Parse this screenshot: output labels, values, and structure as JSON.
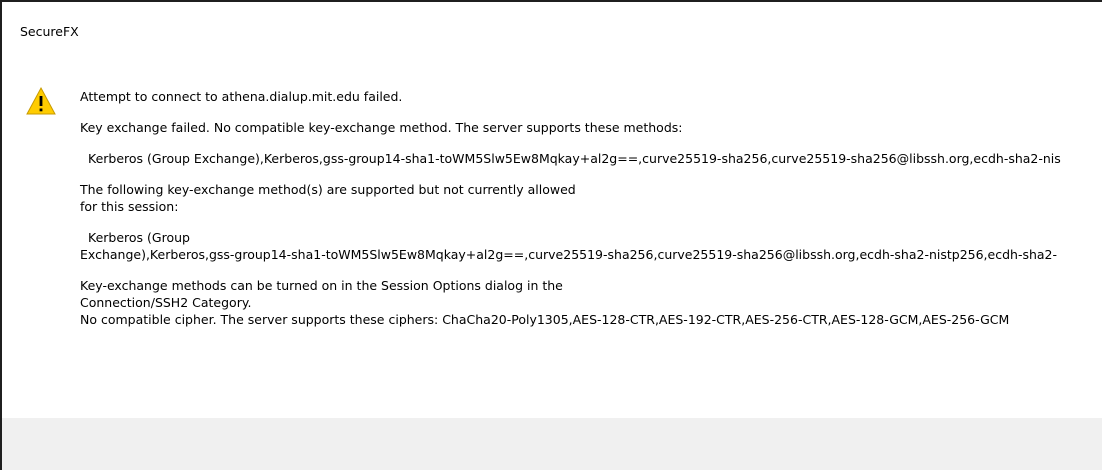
{
  "window": {
    "title": "SecureFX",
    "icon": "warning-icon",
    "footer_color": "#f0f0f0"
  },
  "message": {
    "line1": "Attempt to connect to athena.dialup.mit.edu failed.",
    "line2": "Key exchange failed. No compatible key-exchange method. The server supports these methods:",
    "line3": "Kerberos (Group Exchange),Kerberos,gss-group14-sha1-toWM5Slw5Ew8Mqkay+al2g==,curve25519-sha256,curve25519-sha256@libssh.org,ecdh-sha2-nis",
    "line4a": "The following key-exchange method(s) are supported but not currently allowed",
    "line4b": "for this session:",
    "line5a": "Kerberos (Group",
    "line5b": "Exchange),Kerberos,gss-group14-sha1-toWM5Slw5Ew8Mqkay+al2g==,curve25519-sha256,curve25519-sha256@libssh.org,ecdh-sha2-nistp256,ecdh-sha2-",
    "line6a": "Key-exchange methods can be turned on in the Session Options dialog in the",
    "line6b": "Connection/SSH2 Category.",
    "line6c": "No compatible cipher. The server supports these ciphers: ChaCha20-Poly1305,AES-128-CTR,AES-192-CTR,AES-256-CTR,AES-128-GCM,AES-256-GCM"
  }
}
